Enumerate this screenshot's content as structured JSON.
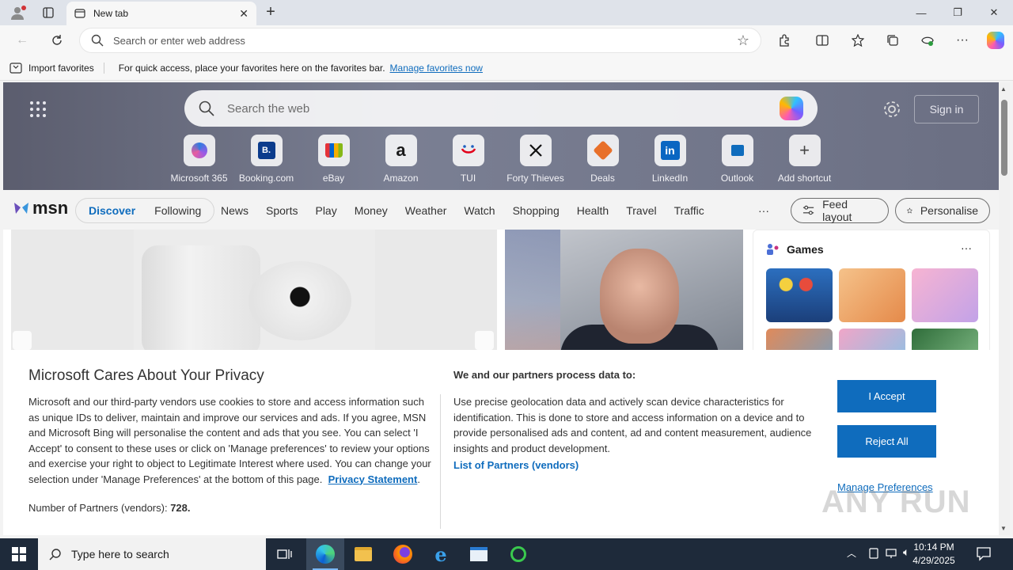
{
  "browser": {
    "tab_title": "New tab",
    "address_placeholder": "Search or enter web address"
  },
  "favorites_bar": {
    "import_label": "Import favorites",
    "hint_text": "For quick access, place your favorites here on the favorites bar.",
    "manage_link": "Manage favorites now"
  },
  "newtab": {
    "search_placeholder": "Search the web",
    "signin_label": "Sign in",
    "shortcuts": [
      {
        "label": "Microsoft 365",
        "icon": "microsoft-365-icon"
      },
      {
        "label": "Booking.com",
        "icon": "booking-icon",
        "glyph": "B."
      },
      {
        "label": "eBay",
        "icon": "ebay-icon"
      },
      {
        "label": "Amazon",
        "icon": "amazon-icon",
        "glyph": "a"
      },
      {
        "label": "TUI",
        "icon": "tui-icon"
      },
      {
        "label": "Forty Thieves",
        "icon": "forty-thieves-icon"
      },
      {
        "label": "Deals",
        "icon": "deals-icon"
      },
      {
        "label": "LinkedIn",
        "icon": "linkedin-icon",
        "glyph": "in"
      },
      {
        "label": "Outlook",
        "icon": "outlook-icon"
      },
      {
        "label": "Add shortcut",
        "icon": "plus-icon",
        "glyph": "+"
      }
    ]
  },
  "msn": {
    "logo_text": "msn",
    "tabs": [
      "Discover",
      "Following"
    ],
    "nav": [
      "News",
      "Sports",
      "Play",
      "Money",
      "Weather",
      "Watch",
      "Shopping",
      "Health",
      "Travel",
      "Traffic"
    ],
    "more": "···",
    "feed_layout": "Feed layout",
    "personalise": "Personalise",
    "games_title": "Games",
    "games_more": "···"
  },
  "consent": {
    "title": "Microsoft Cares About Your Privacy",
    "body": "Microsoft and our third-party vendors use cookies to store and access information such as unique IDs to deliver, maintain and improve our services and ads. If you agree, MSN and Microsoft Bing will personalise the content and ads that you see. You can select 'I Accept' to consent to these uses or click on 'Manage preferences' to review your options and exercise your right to object to Legitimate Interest where used.  You can change your selection under 'Manage Preferences' at the bottom of this page.",
    "privacy_link": "Privacy Statement",
    "partners_count_label": "Number of Partners (vendors):",
    "partners_count": "728.",
    "process_heading": "We and our partners process data to:",
    "process_body": "Use precise geolocation data and actively scan device characteristics for identification. This is done to store and access information on a device and to provide personalised ads and content, ad and content measurement, audience insights and product development.",
    "list_partners": "List of Partners (vendors)",
    "accept": "I Accept",
    "reject": "Reject All",
    "manage": "Manage Preferences"
  },
  "watermark": "ANY RUN",
  "taskbar": {
    "search_placeholder": "Type here to search",
    "time": "10:14 PM",
    "date": "4/29/2025"
  }
}
